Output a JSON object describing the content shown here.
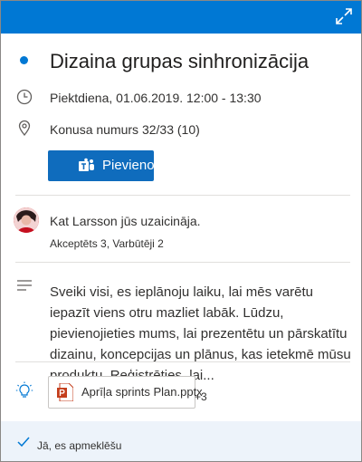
{
  "event": {
    "title": "Dizaina grupas sinhronizācija",
    "datetime": "Piektdiena, 01.06.2019. 12:00 - 13:30",
    "location": "Konusa numurs 32/33 (10)",
    "join_label": "Pievienoties"
  },
  "invite": {
    "text": "Kat Larsson jūs uzaicināja.",
    "responses": "Akceptēts 3, Varbūtēji 2"
  },
  "description": "Sveiki visi, es ieplānoju laiku, lai mēs varētu iepazīt viens otru mazliet labāk. Lūdzu, pievienojieties mums, lai prezentētu un pārskatītu dizainu, koncepcijas un plānus, kas ietekmē mūsu produktu. Reģistrēties, lai...",
  "attachments": {
    "first_name": "Aprīļa sprints Plan.pptx",
    "more_count": "+3"
  },
  "rsvp": {
    "label": "Jā, es apmeklēšu"
  },
  "colors": {
    "accent": "#0078d4",
    "button": "#0f6cbd",
    "footer_bg": "#edf3fa",
    "ppt": "#c43e1c"
  },
  "icons": [
    "expand-icon",
    "calendar-color-dot",
    "clock-icon",
    "location-pin-icon",
    "teams-icon",
    "avatar",
    "description-lines-icon",
    "lightbulb-icon",
    "powerpoint-icon",
    "checkmark-icon"
  ]
}
